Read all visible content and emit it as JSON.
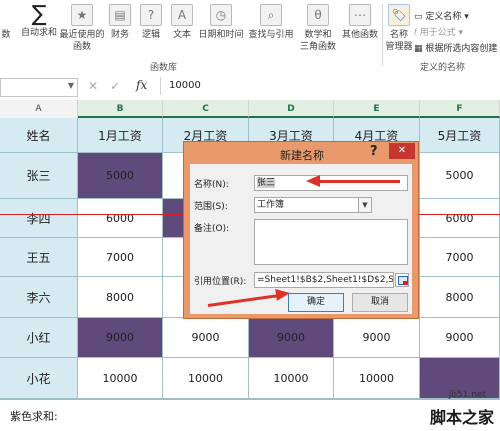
{
  "ribbon": {
    "items": [
      {
        "label": "数",
        "icon": "insert-function-icon"
      },
      {
        "label": "自动求和",
        "icon": "autosum-icon"
      },
      {
        "label": "最近使用的函数",
        "icon": "recent-functions-icon"
      },
      {
        "label": "财务",
        "icon": "financial-icon"
      },
      {
        "label": "逻辑",
        "icon": "logical-icon"
      },
      {
        "label": "文本",
        "icon": "text-icon"
      },
      {
        "label": "日期和时间",
        "icon": "date-time-icon"
      },
      {
        "label": "查找与引用",
        "icon": "lookup-reference-icon"
      },
      {
        "label": "数学和三角函数",
        "icon": "math-trig-icon"
      },
      {
        "label": "其他函数",
        "icon": "more-functions-icon"
      },
      {
        "label": "名称管理器",
        "icon": "name-manager-icon"
      }
    ],
    "ribbon_glyphs": {
      "sigma": "∑",
      "star": "★",
      "question": "?",
      "letter_a": "A",
      "theta": "θ",
      "search": "⌕",
      "dots": "⋯",
      "clock": "◷",
      "money": "▤",
      "tag": "🏷"
    },
    "group_function_library": "函数库",
    "group_defined_names": "定义的名称",
    "defined_names": {
      "define_name": "定义名称",
      "use_in_formula": "用于公式",
      "create_from_selection": "根据所选内容创建"
    },
    "recent_prefix": "最近使用的",
    "recent_suffix": "函数",
    "name_mgr_line1": "名称",
    "name_mgr_line2": "管理器",
    "math_line1": "数学和",
    "math_line2": "三角函数",
    "more_functions": "其他函数",
    "lookup": "查找与引用",
    "datetime": "日期和时间"
  },
  "formula_bar": {
    "name_box_value": "",
    "cancel_glyph": "✕",
    "enter_glyph": "✓",
    "fx_glyph": "fx",
    "formula_value": "10000"
  },
  "columns": [
    "A",
    "B",
    "C",
    "D",
    "E",
    "F"
  ],
  "sheet": {
    "headers": [
      "姓名",
      "1月工资",
      "2月工资",
      "3月工资",
      "4月工资",
      "5月工资"
    ],
    "rows": [
      [
        "张三",
        "5000",
        "",
        "",
        "",
        "5000"
      ],
      [
        "李四",
        "6000",
        "",
        "",
        "",
        "6000"
      ],
      [
        "王五",
        "7000",
        "",
        "",
        "",
        "7000"
      ],
      [
        "李六",
        "8000",
        "",
        "",
        "",
        "8000"
      ],
      [
        "小红",
        "9000",
        "9000",
        "9000",
        "9000",
        "9000"
      ],
      [
        "小花",
        "10000",
        "10000",
        "10000",
        "10000",
        ""
      ]
    ],
    "sum_label": "紫色求和:",
    "highlight_color": "#604a7b"
  },
  "dialog": {
    "title": "新建名称",
    "help": "?",
    "close": "✕",
    "name_label": "名称(N):",
    "name_value": "张三",
    "scope_label": "范围(S):",
    "scope_value": "工作簿",
    "comment_label": "备注(O):",
    "comment_value": "",
    "refers_label": "引用位置(R):",
    "refers_value": "=Sheet1!$B$2,Sheet1!$D$2,She",
    "ok": "确定",
    "cancel": "取消",
    "combo_arrow": "▼"
  },
  "colors": {
    "header_fill": "#d6eaf2",
    "purple_fill": "#604a7b",
    "dialog_frame": "#e99a6c",
    "close_red": "#c7372f",
    "arrow_red": "#e0302a"
  },
  "watermark": {
    "url": "jb51.net",
    "name": "脚本之家"
  }
}
